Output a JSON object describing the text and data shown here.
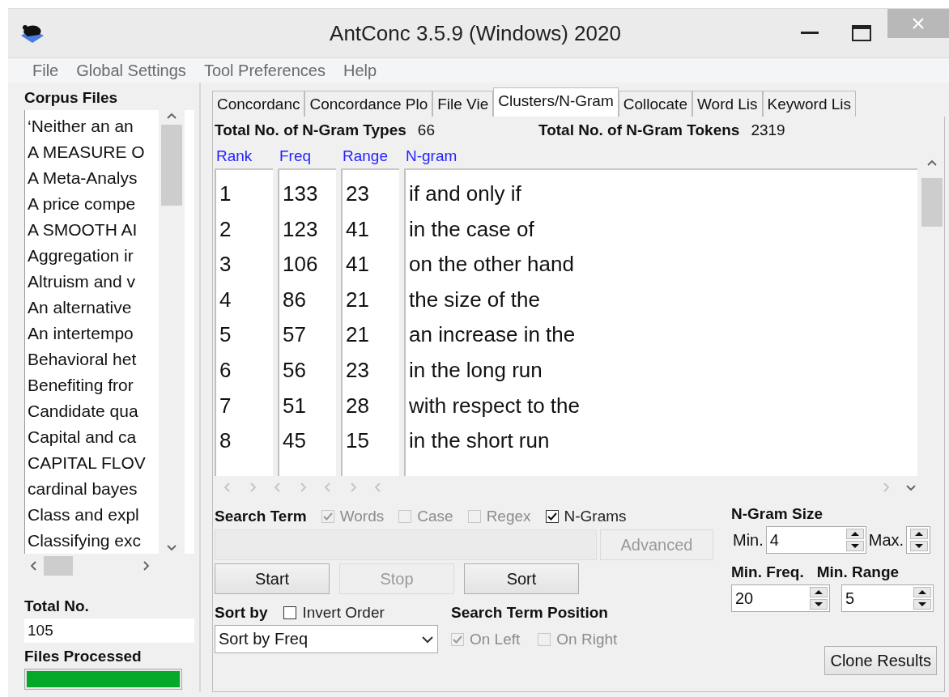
{
  "window": {
    "title": "AntConc 3.5.9 (Windows) 2020"
  },
  "menu": [
    "File",
    "Global Settings",
    "Tool Preferences",
    "Help"
  ],
  "corpus_files": {
    "title": "Corpus Files",
    "files": [
      "‘Neither an an",
      "A MEASURE O",
      "A Meta-Analys",
      "A price compe",
      "A SMOOTH AI",
      "Aggregation ir",
      "Altruism and v",
      "An alternative",
      "An intertempo",
      "Behavioral het",
      "Benefiting fror",
      "Candidate qua",
      "Capital and ca",
      "CAPITAL FLOV",
      "cardinal bayes",
      "Class and expl",
      "Classifying exc"
    ],
    "total_label": "Total No.",
    "total": "105",
    "processed_label": "Files Processed",
    "progress": {
      "level": 1
    }
  },
  "tabs": [
    {
      "label": "Concordanc",
      "selected": false
    },
    {
      "label": "Concordance Plo",
      "selected": false
    },
    {
      "label": "File Vie",
      "selected": false
    },
    {
      "label": "Clusters/N-Gram",
      "selected": true
    },
    {
      "label": "Collocate",
      "selected": false
    },
    {
      "label": "Word Lis",
      "selected": false
    },
    {
      "label": "Keyword Lis",
      "selected": false
    }
  ],
  "summary": {
    "types_label": "Total No. of N-Gram Types",
    "types": "66",
    "tokens_label": "Total No. of N-Gram Tokens",
    "tokens": "2319"
  },
  "table": {
    "columns": [
      "Rank",
      "Freq",
      "Range",
      "N-gram"
    ],
    "rows": [
      [
        "1",
        "133",
        "23",
        "if and only if"
      ],
      [
        "2",
        "123",
        "41",
        "in the case of"
      ],
      [
        "3",
        "106",
        "41",
        "on the other hand"
      ],
      [
        "4",
        "86",
        "21",
        "the size of the"
      ],
      [
        "5",
        "57",
        "21",
        "an increase in the"
      ],
      [
        "6",
        "56",
        "23",
        "in the long run"
      ],
      [
        "7",
        "51",
        "28",
        "with respect to the"
      ],
      [
        "8",
        "45",
        "15",
        "in the short run"
      ]
    ]
  },
  "search": {
    "label": "Search Term",
    "options": [
      {
        "label": "Words",
        "checked": true,
        "disabled": true
      },
      {
        "label": "Case",
        "checked": false,
        "disabled": true
      },
      {
        "label": "Regex",
        "checked": false,
        "disabled": true
      },
      {
        "label": "N-Grams",
        "checked": true,
        "disabled": false
      }
    ],
    "advanced": {
      "label": "Advanced",
      "disabled": true
    }
  },
  "buttons": [
    {
      "label": "Start",
      "disabled": false
    },
    {
      "label": "Stop",
      "disabled": true
    },
    {
      "label": "Sort",
      "disabled": false
    }
  ],
  "sort": {
    "label": "Sort by",
    "invert": {
      "label": "Invert Order",
      "checked": false,
      "disabled": false
    },
    "value": "Sort by Freq"
  },
  "position": {
    "label": "Search Term Position",
    "options": [
      {
        "label": "On Left",
        "checked": true,
        "disabled": true
      },
      {
        "label": "On Right",
        "checked": false,
        "disabled": true
      }
    ]
  },
  "ngram_size": {
    "label": "N-Gram Size",
    "min_label": "Min.",
    "min": "4",
    "max_label": "Max."
  },
  "min_freq": {
    "label": "Min. Freq.",
    "value": "20"
  },
  "min_range": {
    "label": "Min. Range",
    "value": "5"
  },
  "clone_button": "Clone Results"
}
